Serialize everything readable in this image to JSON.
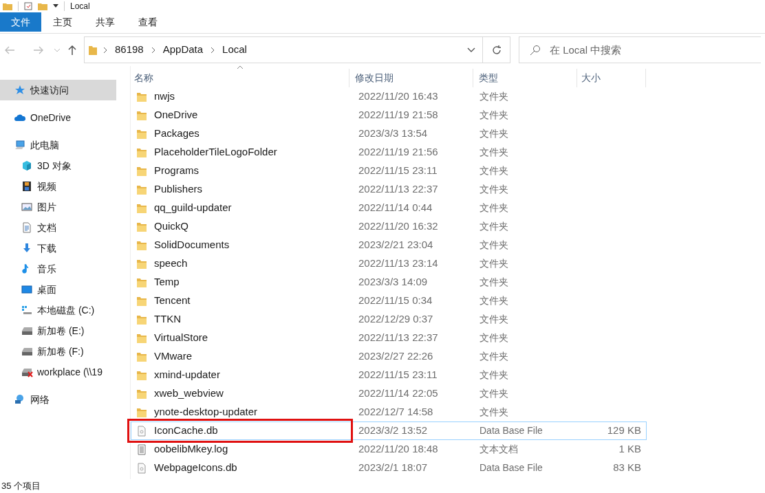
{
  "window": {
    "title": "Local"
  },
  "ribbon_tabs": [
    {
      "label": "文件",
      "selected": true
    },
    {
      "label": "主页",
      "selected": false
    },
    {
      "label": "共享",
      "selected": false
    },
    {
      "label": "查看",
      "selected": false
    }
  ],
  "address_bar": {
    "path": [
      "86198",
      "AppData",
      "Local"
    ]
  },
  "search": {
    "placeholder": "在 Local 中搜索"
  },
  "sidebar": {
    "items": [
      {
        "label": "快速访问",
        "selected": true
      },
      {
        "label": "OneDrive",
        "selected": false
      },
      {
        "label": "此电脑",
        "selected": false,
        "children": [
          {
            "label": "3D 对象",
            "selected": false
          },
          {
            "label": "视频",
            "selected": false
          },
          {
            "label": "图片",
            "selected": false
          },
          {
            "label": "文档",
            "selected": false
          },
          {
            "label": "下载",
            "selected": false
          },
          {
            "label": "音乐",
            "selected": false
          },
          {
            "label": "桌面",
            "selected": false
          },
          {
            "label": "本地磁盘 (C:)",
            "selected": false
          },
          {
            "label": "新加卷 (E:)",
            "selected": false
          },
          {
            "label": "新加卷 (F:)",
            "selected": false
          },
          {
            "label": "workplace (\\\\19",
            "selected": false
          }
        ]
      },
      {
        "label": "网络",
        "selected": false
      }
    ]
  },
  "table": {
    "columns": [
      "名称",
      "修改日期",
      "类型",
      "大小"
    ],
    "rows": [
      {
        "kind": "folder",
        "name": "nwjs",
        "date": "2022/11/20 16:43",
        "type": "文件夹",
        "selected": false
      },
      {
        "kind": "folder",
        "name": "OneDrive",
        "date": "2022/11/19 21:58",
        "type": "文件夹",
        "selected": false
      },
      {
        "kind": "folder",
        "name": "Packages",
        "date": "2023/3/3 13:54",
        "type": "文件夹",
        "selected": false
      },
      {
        "kind": "folder",
        "name": "PlaceholderTileLogoFolder",
        "date": "2022/11/19 21:56",
        "type": "文件夹",
        "selected": false
      },
      {
        "kind": "folder",
        "name": "Programs",
        "date": "2022/11/15 23:11",
        "type": "文件夹",
        "selected": false
      },
      {
        "kind": "folder",
        "name": "Publishers",
        "date": "2022/11/13 22:37",
        "type": "文件夹",
        "selected": false
      },
      {
        "kind": "folder",
        "name": "qq_guild-updater",
        "date": "2022/11/14 0:44",
        "type": "文件夹",
        "selected": false
      },
      {
        "kind": "folder",
        "name": "QuickQ",
        "date": "2022/11/20 16:32",
        "type": "文件夹",
        "selected": false
      },
      {
        "kind": "folder",
        "name": "SolidDocuments",
        "date": "2023/2/21 23:04",
        "type": "文件夹",
        "selected": false
      },
      {
        "kind": "folder",
        "name": "speech",
        "date": "2022/11/13 23:14",
        "type": "文件夹",
        "selected": false
      },
      {
        "kind": "folder",
        "name": "Temp",
        "date": "2023/3/3 14:09",
        "type": "文件夹",
        "selected": false
      },
      {
        "kind": "folder",
        "name": "Tencent",
        "date": "2022/11/15 0:34",
        "type": "文件夹",
        "selected": false
      },
      {
        "kind": "folder",
        "name": "TTKN",
        "date": "2022/12/29 0:37",
        "type": "文件夹",
        "selected": false
      },
      {
        "kind": "folder",
        "name": "VirtualStore",
        "date": "2022/11/13 22:37",
        "type": "文件夹",
        "selected": false
      },
      {
        "kind": "folder",
        "name": "VMware",
        "date": "2023/2/27 22:26",
        "type": "文件夹",
        "selected": false
      },
      {
        "kind": "folder",
        "name": "xmind-updater",
        "date": "2022/11/15 23:11",
        "type": "文件夹",
        "selected": false
      },
      {
        "kind": "folder",
        "name": "xweb_webview",
        "date": "2022/11/14 22:05",
        "type": "文件夹",
        "selected": false
      },
      {
        "kind": "folder",
        "name": "ynote-desktop-updater",
        "date": "2022/12/7 14:58",
        "type": "文件夹",
        "selected": false
      },
      {
        "kind": "dbfile",
        "name": "IconCache.db",
        "date": "2023/3/2 13:52",
        "type": "Data Base File",
        "size": "129 KB",
        "selected": true,
        "highlighted": true
      },
      {
        "kind": "textfile",
        "name": "oobelibMkey.log",
        "date": "2022/11/20 18:48",
        "type": "文本文档",
        "size": "1 KB",
        "selected": false
      },
      {
        "kind": "dbfile",
        "name": "WebpageIcons.db",
        "date": "2023/2/1 18:07",
        "type": "Data Base File",
        "size": "83 KB",
        "selected": false
      }
    ]
  },
  "status_bar": {
    "item_count": "35 个项目"
  }
}
